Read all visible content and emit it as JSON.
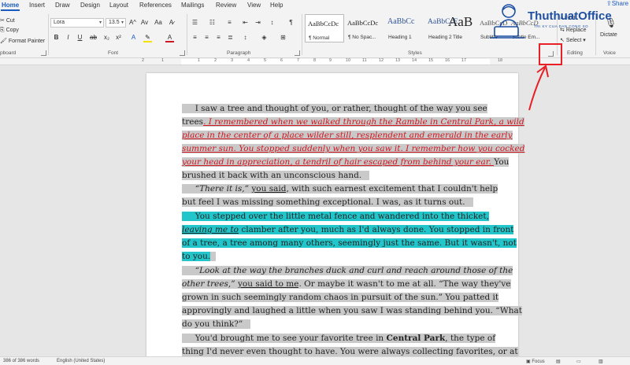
{
  "menu": {
    "tabs": [
      "Home",
      "Insert",
      "Draw",
      "Design",
      "Layout",
      "References",
      "Mailings",
      "Review",
      "View",
      "Help"
    ],
    "share_label": "Share"
  },
  "ribbon": {
    "clipboard": {
      "cut": "Cut",
      "copy": "Copy",
      "format_painter": "Format Painter",
      "label": "pboard"
    },
    "font": {
      "font_name": "Lora",
      "font_size": "13.5",
      "grow_icon": "A^",
      "shrink_icon": "Av",
      "case_label": "Aa",
      "bold": "B",
      "italic": "I",
      "underline": "U",
      "strike": "ab",
      "subscript": "x₂",
      "superscript": "x²",
      "label": "Font"
    },
    "paragraph": {
      "label": "Paragraph"
    },
    "styles": {
      "label": "Styles",
      "items": [
        {
          "preview": "AaBbCcDc",
          "name": "¶ Normal"
        },
        {
          "preview": "AaBbCcDc",
          "name": "¶ No Spac..."
        },
        {
          "preview": "AaBbCc",
          "name": "Heading 1"
        },
        {
          "preview": "AaBbCcE",
          "name": "Heading 2"
        },
        {
          "preview": "AaB",
          "name": "Title"
        },
        {
          "preview": "AaBbCcD",
          "name": "Subtitle"
        },
        {
          "preview": "AaBbCcD",
          "name": "Subtle Em..."
        }
      ]
    },
    "editing": {
      "find": "Find",
      "replace": "Replace",
      "select": "Select",
      "label": "Editing"
    },
    "voice": {
      "dictate": "Dictate",
      "label": "Voice"
    }
  },
  "logo": {
    "text": "ThuthuatOffice",
    "subtitle": "TRI KY CUA DAN CONG SO"
  },
  "ruler": {
    "numbers": [
      "2",
      "1",
      "1",
      "2",
      "3",
      "4",
      "5",
      "6",
      "7",
      "8",
      "9",
      "10",
      "11",
      "12",
      "13",
      "14",
      "15",
      "16",
      "17",
      "18"
    ]
  },
  "document": {
    "lines": [
      [
        {
          "t": "     I saw a tree and thought of you, or rather, thought of the way you see",
          "c": "hl-gray"
        }
      ],
      [
        {
          "t": "trees",
          "c": "hl-gray"
        },
        {
          "t": ". I remembered when we walked through the Ramble in Central Park, a wild",
          "c": "hl-gray red"
        }
      ],
      [
        {
          "t": "place in the center of a place wilder still, resplendent and emerald in the early",
          "c": "hl-gray red"
        }
      ],
      [
        {
          "t": "summer sun. You stopped suddenly when you saw it. I remember how you cocked",
          "c": "hl-gray red"
        }
      ],
      [
        {
          "t": "your head in appreciation, a tendril of hair escaped from behind your ear. ",
          "c": "hl-gray red"
        },
        {
          "t": "You",
          "c": "hl-gray"
        }
      ],
      [
        {
          "t": "brushed it back with an unconscious hand.   ",
          "c": "hl-gray"
        }
      ],
      [
        {
          "t": "     ",
          "c": "hl-gray"
        },
        {
          "t": "“There it is,”",
          "c": "hl-gray ital"
        },
        {
          "t": " ",
          "c": "hl-gray"
        },
        {
          "t": "you said",
          "c": "hl-gray uline"
        },
        {
          "t": ", with such earnest excitement that I couldn't help",
          "c": "hl-gray"
        }
      ],
      [
        {
          "t": "but feel I was missing something exceptional. I was, as it turns out.   ",
          "c": "hl-gray"
        }
      ],
      [
        {
          "t": "     You stepped over the little metal fence and wandered into the thicket,",
          "c": "hl-cyan"
        }
      ],
      [
        {
          "t": "leaving me to",
          "c": "hl-cyan ital uline"
        },
        {
          "t": " clamber after you, much as I'd always done. You stopped in front",
          "c": "hl-cyan"
        }
      ],
      [
        {
          "t": "of a tree, a tree among many others, seemingly just the same. But it wasn't, not",
          "c": "hl-cyan"
        }
      ],
      [
        {
          "t": "to you.",
          "c": "hl-cyan"
        },
        {
          "t": "  ",
          "c": "hl-gray"
        }
      ],
      [
        {
          "t": "     ",
          "c": "hl-gray"
        },
        {
          "t": "“Look at the way the branches duck and curl and reach around those of the",
          "c": "hl-gray ital"
        }
      ],
      [
        {
          "t": "other trees,”",
          "c": "hl-gray ital"
        },
        {
          "t": " ",
          "c": "hl-gray"
        },
        {
          "t": "you said to me",
          "c": "hl-gray uline"
        },
        {
          "t": ". Or maybe it wasn't to me at all. “The way they've",
          "c": "hl-gray"
        }
      ],
      [
        {
          "t": "grown in such seemingly random chaos in pursuit of the sun.” You patted it",
          "c": "hl-gray"
        }
      ],
      [
        {
          "t": "approvingly and laughed a little when you saw I was standing behind you. “What",
          "c": "hl-gray"
        }
      ],
      [
        {
          "t": "do you think?”   ",
          "c": "hl-gray"
        }
      ],
      [
        {
          "t": "     You'd brought me to see your favorite tree in ",
          "c": "hl-gray"
        },
        {
          "t": "Central Park",
          "c": "hl-gray bold"
        },
        {
          "t": ", the type of",
          "c": "hl-gray"
        }
      ],
      [
        {
          "t": "thing I'd never even thought to have. You were always collecting favorites, or at",
          "c": "hl-gray"
        }
      ]
    ]
  },
  "status": {
    "words": "386 of 386 words",
    "language": "English (United States)",
    "focus": "Focus"
  },
  "colors": {
    "accent": "#185abd",
    "annotation": "#e81f25",
    "highlight_gray": "#c9c9c9",
    "highlight_cyan": "#22c5c9",
    "red_text": "#d0161f"
  }
}
